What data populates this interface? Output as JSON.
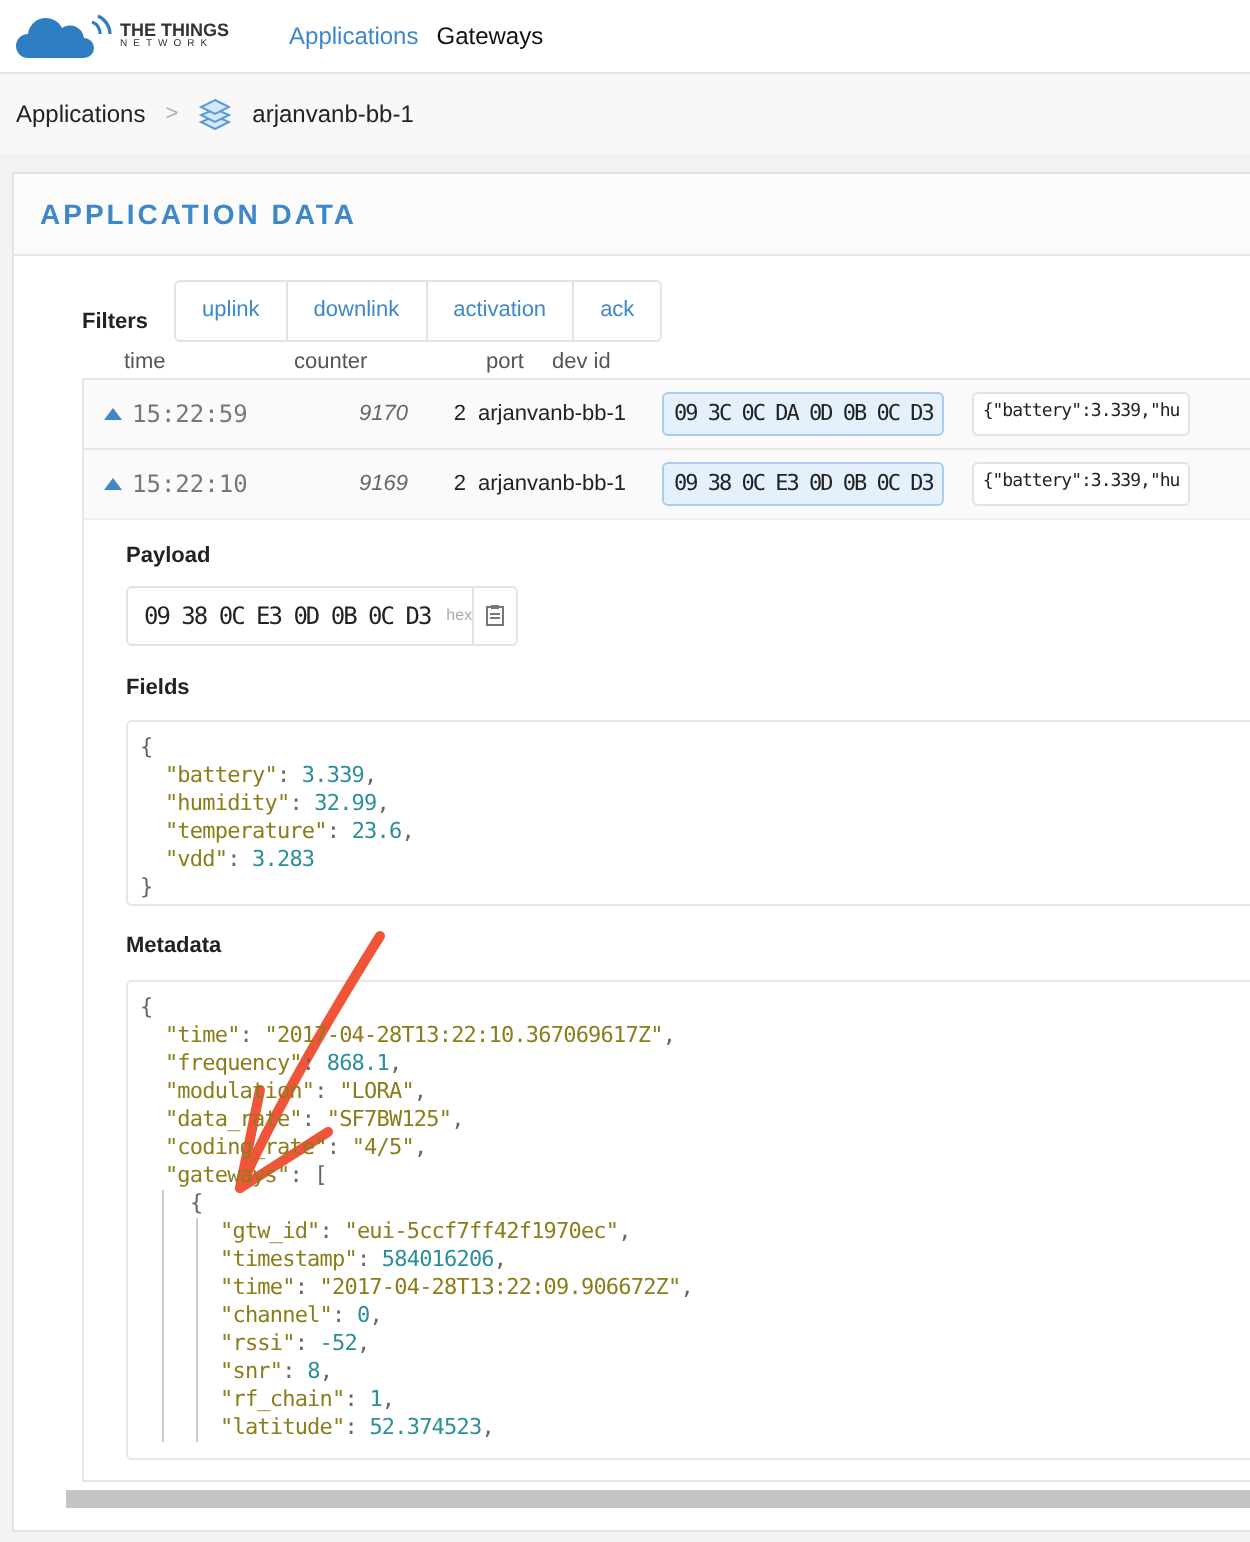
{
  "nav": {
    "logo_line1": "THE THINGS",
    "logo_line2": "NETWORK",
    "items": [
      {
        "label": "Applications",
        "selected": true
      },
      {
        "label": "Gateways",
        "selected": false
      }
    ]
  },
  "breadcrumb": {
    "parent": "Applications",
    "separator": ">",
    "current": "arjanvanb-bb-1"
  },
  "title": "APPLICATION DATA",
  "filters": {
    "label": "Filters",
    "buttons": [
      "uplink",
      "downlink",
      "activation",
      "ack"
    ]
  },
  "columns": [
    "time",
    "counter",
    "port",
    "dev id"
  ],
  "rows": [
    {
      "time": "15:22:59",
      "counter": "9170",
      "port": "2",
      "dev_id": "arjanvanb-bb-1",
      "payload": "09 3C 0C DA 0D 0B 0C D3",
      "fields": "{\"battery\":3.339,\"hu"
    },
    {
      "time": "15:22:10",
      "counter": "9169",
      "port": "2",
      "dev_id": "arjanvanb-bb-1",
      "payload": "09 38 0C E3 0D 0B 0C D3",
      "fields": "{\"battery\":3.339,\"hu",
      "detail": {
        "payload_label": "Payload",
        "payload": "09 38 0C E3 0D 0B 0C D3",
        "payload_format": "hex",
        "fields_label": "Fields",
        "fields_lines": [
          "{",
          "  \"battery\": 3.339,",
          "  \"humidity\": 32.99,",
          "  \"temperature\": 23.6,",
          "  \"vdd\": 3.283",
          "}"
        ],
        "metadata_label": "Metadata",
        "metadata_lines": [
          "{",
          "  \"time\": \"2017-04-28T13:22:10.367069617Z\",",
          "  \"frequency\": 868.1,",
          "  \"modulation\": \"LORA\",",
          "  \"data_rate\": \"SF7BW125\",",
          "  \"coding_rate\": \"4/5\",",
          "  \"gateways\": ["
        ],
        "gateway_open": "{",
        "gateway_lines": [
          "\"gtw_id\": \"eui-5ccf7ff42f1970ec\",",
          "\"timestamp\": 584016206,",
          "\"time\": \"2017-04-28T13:22:09.906672Z\",",
          "\"channel\": 0,",
          "\"rssi\": -52,",
          "\"snr\": 8,",
          "\"rf_chain\": 1,",
          "\"latitude\": 52.374523,"
        ]
      }
    }
  ]
}
